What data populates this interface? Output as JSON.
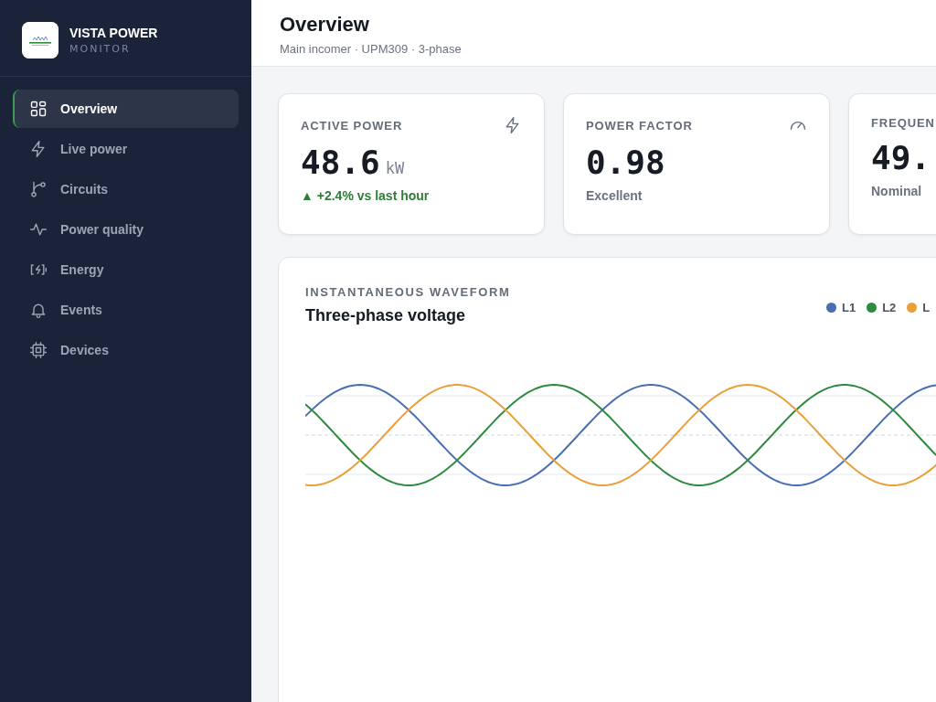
{
  "brand": {
    "name": "VISTA POWER",
    "subtitle": "MONITOR"
  },
  "sidebar": {
    "items": [
      {
        "label": "Overview",
        "selected": true
      },
      {
        "label": "Live power",
        "selected": false
      },
      {
        "label": "Circuits",
        "selected": false
      },
      {
        "label": "Power quality",
        "selected": false
      },
      {
        "label": "Energy",
        "selected": false
      },
      {
        "label": "Events",
        "selected": false
      },
      {
        "label": "Devices",
        "selected": false
      }
    ]
  },
  "header": {
    "title": "Overview",
    "subtitle": "Main incomer · UPM309 · 3-phase"
  },
  "cards": [
    {
      "label": "ACTIVE POWER",
      "value": "48.6",
      "unit": "kW",
      "note": "+2.4% vs last hour",
      "trend": "▲",
      "kind": "trend"
    },
    {
      "label": "POWER FACTOR",
      "value": "0.98",
      "note": "Excellent",
      "kind": "plain"
    },
    {
      "label": "FREQUEN",
      "value": "49.",
      "note": "Nominal",
      "kind": "plain"
    }
  ],
  "waveform": {
    "eyebrow": "INSTANTANEOUS WAVEFORM",
    "title": "Three-phase voltage",
    "legend": [
      {
        "label": "L1",
        "color": "#4a6fb0"
      },
      {
        "label": "L2",
        "color": "#2e8b3e"
      },
      {
        "label": "L",
        "color": "#e8a03a"
      }
    ]
  }
}
